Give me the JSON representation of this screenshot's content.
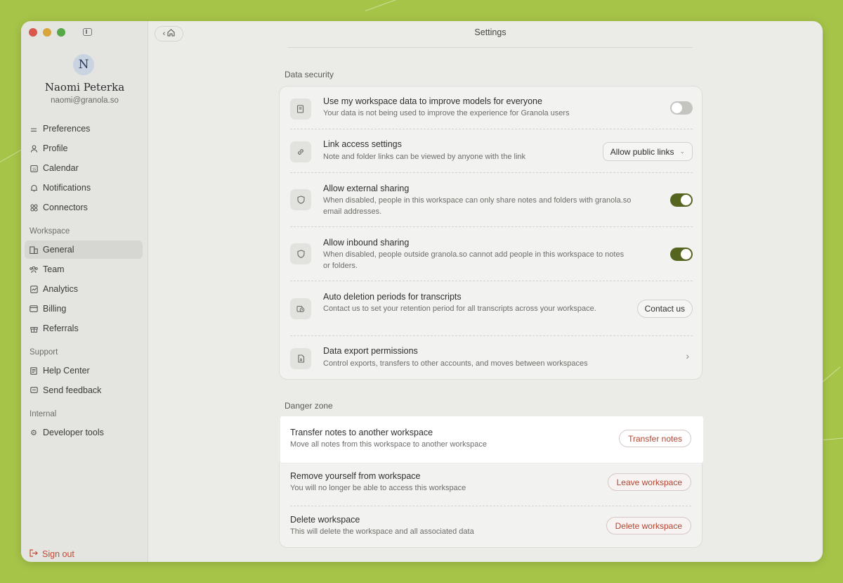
{
  "sidebar": {
    "avatar_initial": "N",
    "user_name": "Naomi Peterka",
    "user_email": "naomi@granola.so",
    "items": [
      {
        "label": "Preferences",
        "icon": "sliders-icon"
      },
      {
        "label": "Profile",
        "icon": "user-icon"
      },
      {
        "label": "Calendar",
        "icon": "calendar-icon"
      },
      {
        "label": "Notifications",
        "icon": "bell-icon"
      },
      {
        "label": "Connectors",
        "icon": "connectors-icon"
      }
    ],
    "workspace_label": "Workspace",
    "workspace_items": [
      {
        "label": "General",
        "icon": "building-icon",
        "active": true
      },
      {
        "label": "Team",
        "icon": "team-icon"
      },
      {
        "label": "Analytics",
        "icon": "analytics-icon"
      },
      {
        "label": "Billing",
        "icon": "card-icon"
      },
      {
        "label": "Referrals",
        "icon": "gift-icon"
      }
    ],
    "support_label": "Support",
    "support_items": [
      {
        "label": "Help Center",
        "icon": "book-icon"
      },
      {
        "label": "Send feedback",
        "icon": "chat-icon"
      }
    ],
    "internal_label": "Internal",
    "internal_items": [
      {
        "label": "Developer tools",
        "icon": "gear-icon"
      }
    ],
    "sign_out": "Sign out"
  },
  "window": {
    "title": "Settings"
  },
  "data_security": {
    "label": "Data security",
    "rows": [
      {
        "title": "Use my workspace data to improve models for everyone",
        "desc": "Your data is not being used to improve the experience for Granola users",
        "control": "toggle",
        "on": false
      },
      {
        "title": "Link access settings",
        "desc": "Note and folder links can be viewed by anyone with the link",
        "control": "select",
        "value": "Allow public links"
      },
      {
        "title": "Allow external sharing",
        "desc": "When disabled, people in this workspace can only share notes and folders with granola.so email addresses.",
        "control": "toggle",
        "on": true
      },
      {
        "title": "Allow inbound sharing",
        "desc": "When disabled, people outside granola.so cannot add people in this workspace to notes or folders.",
        "control": "toggle",
        "on": true
      },
      {
        "title": "Auto deletion periods for transcripts",
        "desc": "Contact us to set your retention period for all transcripts across your workspace.",
        "control": "button",
        "button_label": "Contact us"
      },
      {
        "title": "Data export permissions",
        "desc": "Control exports, transfers to other accounts, and moves between workspaces",
        "control": "chevron"
      }
    ]
  },
  "danger_zone": {
    "label": "Danger zone",
    "rows": [
      {
        "title": "Transfer notes to another workspace",
        "desc": "Move all notes from this workspace to another workspace",
        "button_label": "Transfer notes"
      },
      {
        "title": "Remove yourself from workspace",
        "desc": "You will no longer be able to access this workspace",
        "button_label": "Leave workspace"
      },
      {
        "title": "Delete workspace",
        "desc": "This will delete the workspace and all associated data",
        "button_label": "Delete workspace"
      }
    ]
  },
  "colors": {
    "background": "#a6c448",
    "toggle_on": "#55651f",
    "danger_text": "#b44530"
  }
}
